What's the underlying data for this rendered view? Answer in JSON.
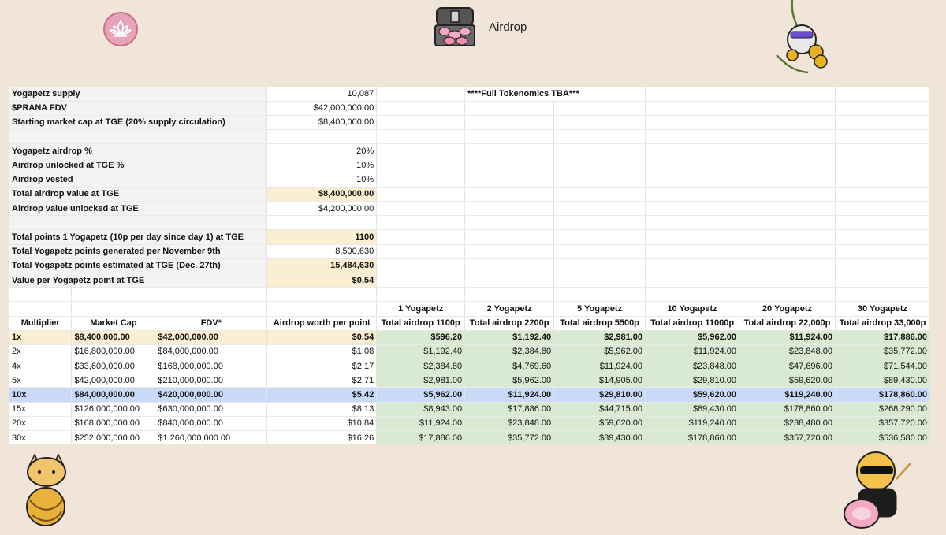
{
  "header": {
    "title": "Airdrop"
  },
  "summary": {
    "supply_label": "Yogapetz supply",
    "supply_value": "10,087",
    "note": "****Full Tokenomics TBA***",
    "fdv_label": "$PRANA FDV",
    "fdv_value": "$42,000,000.00",
    "mcap_label": "Starting market cap at TGE (20% supply circulation)",
    "mcap_value": "$8,400,000.00",
    "airdrop_pct_label": "Yogapetz airdrop %",
    "airdrop_pct_value": "20%",
    "unlocked_pct_label": "Airdrop unlocked at TGE %",
    "unlocked_pct_value": "10%",
    "vested_label": "Airdrop vested",
    "vested_value": "10%",
    "total_value_label": "Total airdrop value at TGE",
    "total_value_value": "$8,400,000.00",
    "unlocked_value_label": "Airdrop value unlocked at TGE",
    "unlocked_value_value": "$4,200,000.00",
    "points_one_label": "Total points 1 Yogapetz (10p per day since day 1) at TGE",
    "points_one_value": "1100",
    "points_generated_label": "Total Yogapetz points generated per November 9th",
    "points_generated_value": "8,500,630",
    "points_estimated_label": "Total Yogapetz points estimated at TGE  (Dec. 27th)",
    "points_estimated_value": "15,484,630",
    "value_per_point_label": "Value per Yogapetz point at TGE",
    "value_per_point_value": "$0.54"
  },
  "grid": {
    "group_headers": [
      "1 Yogapetz",
      "2 Yogapetz",
      "5 Yogapetz",
      "10 Yogapetz",
      "20 Yogapetz",
      "30 Yogapetz"
    ],
    "columns": [
      "Multiplier",
      "Market Cap",
      "FDV*",
      "Airdrop worth per point",
      "Total airdrop 1100p",
      "Total airdrop 2200p",
      "Total airdrop 5500p",
      "Total airdrop 11000p",
      "Total airdrop 22,000p",
      "Total airdrop 33,000p"
    ],
    "rows": [
      [
        "1x",
        "$8,400,000.00",
        "$42,000,000.00",
        "$0.54",
        "$596.20",
        "$1,192.40",
        "$2,981.00",
        "$5,962.00",
        "$11,924.00",
        "$17,886.00"
      ],
      [
        "2x",
        "$16,800,000.00",
        "$84,000,000.00",
        "$1.08",
        "$1,192.40",
        "$2,384.80",
        "$5,962.00",
        "$11,924.00",
        "$23,848.00",
        "$35,772.00"
      ],
      [
        "4x",
        "$33,600,000.00",
        "$168,000,000.00",
        "$2.17",
        "$2,384.80",
        "$4,769.60",
        "$11,924.00",
        "$23,848.00",
        "$47,696.00",
        "$71,544.00"
      ],
      [
        "5x",
        "$42,000,000.00",
        "$210,000,000.00",
        "$2.71",
        "$2,981.00",
        "$5,962.00",
        "$14,905.00",
        "$29,810.00",
        "$59,620.00",
        "$89,430.00"
      ],
      [
        "10x",
        "$84,000,000.00",
        "$420,000,000.00",
        "$5.42",
        "$5,962.00",
        "$11,924.00",
        "$29,810.00",
        "$59,620.00",
        "$119,240.00",
        "$178,860.00"
      ],
      [
        "15x",
        "$126,000,000.00",
        "$630,000,000.00",
        "$8.13",
        "$8,943.00",
        "$17,886.00",
        "$44,715.00",
        "$89,430.00",
        "$178,860.00",
        "$268,290.00"
      ],
      [
        "20x",
        "$168,000,000.00",
        "$840,000,000.00",
        "$10.84",
        "$11,924.00",
        "$23,848.00",
        "$59,620.00",
        "$119,240.00",
        "$238,480.00",
        "$357,720.00"
      ],
      [
        "30x",
        "$252,000,000.00",
        "$1,260,000,000.00",
        "$16.26",
        "$17,886.00",
        "$35,772.00",
        "$89,430.00",
        "$178,860.00",
        "$357,720.00",
        "$536,580.00"
      ]
    ]
  },
  "icons": [
    "lotus-icon",
    "treasure-chest-icon",
    "monkey-mascot-icon",
    "cat-mascot-icon",
    "monkey-sunglasses-icon"
  ],
  "colors": {
    "background": "#f1e4d8",
    "highlight_yellow": "#fcefd1",
    "highlight_green": "#d9ead3",
    "highlight_blue": "#c9daf8"
  }
}
